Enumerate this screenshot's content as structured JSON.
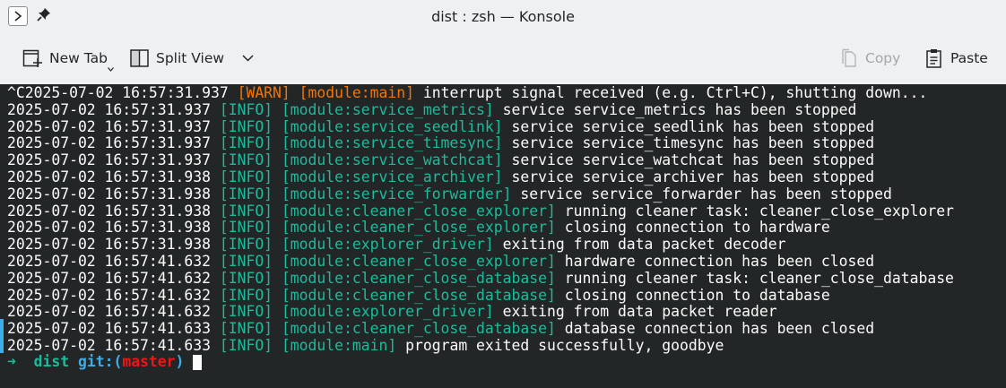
{
  "window": {
    "title": "dist : zsh — Konsole"
  },
  "toolbar": {
    "new_tab": "New Tab",
    "split_view": "Split View",
    "copy": "Copy",
    "paste": "Paste"
  },
  "log_lines": [
    {
      "ts": "^C2025-07-02 16:57:31.937",
      "level": "[WARN]",
      "module": "[module:main]",
      "msg": "interrupt signal received (e.g. Ctrl+C), shutting down..."
    },
    {
      "ts": "2025-07-02 16:57:31.937",
      "level": "[INFO]",
      "module": "[module:service_metrics]",
      "msg": "service service_metrics has been stopped"
    },
    {
      "ts": "2025-07-02 16:57:31.937",
      "level": "[INFO]",
      "module": "[module:service_seedlink]",
      "msg": "service service_seedlink has been stopped"
    },
    {
      "ts": "2025-07-02 16:57:31.937",
      "level": "[INFO]",
      "module": "[module:service_timesync]",
      "msg": "service service_timesync has been stopped"
    },
    {
      "ts": "2025-07-02 16:57:31.937",
      "level": "[INFO]",
      "module": "[module:service_watchcat]",
      "msg": "service service_watchcat has been stopped"
    },
    {
      "ts": "2025-07-02 16:57:31.938",
      "level": "[INFO]",
      "module": "[module:service_archiver]",
      "msg": "service service_archiver has been stopped"
    },
    {
      "ts": "2025-07-02 16:57:31.938",
      "level": "[INFO]",
      "module": "[module:service_forwarder]",
      "msg": "service service_forwarder has been stopped"
    },
    {
      "ts": "2025-07-02 16:57:31.938",
      "level": "[INFO]",
      "module": "[module:cleaner_close_explorer]",
      "msg": "running cleaner task: cleaner_close_explorer"
    },
    {
      "ts": "2025-07-02 16:57:31.938",
      "level": "[INFO]",
      "module": "[module:cleaner_close_explorer]",
      "msg": "closing connection to hardware"
    },
    {
      "ts": "2025-07-02 16:57:31.938",
      "level": "[INFO]",
      "module": "[module:explorer_driver]",
      "msg": "exiting from data packet decoder"
    },
    {
      "ts": "2025-07-02 16:57:41.632",
      "level": "[INFO]",
      "module": "[module:cleaner_close_explorer]",
      "msg": "hardware connection has been closed"
    },
    {
      "ts": "2025-07-02 16:57:41.632",
      "level": "[INFO]",
      "module": "[module:cleaner_close_database]",
      "msg": "running cleaner task: cleaner_close_database"
    },
    {
      "ts": "2025-07-02 16:57:41.632",
      "level": "[INFO]",
      "module": "[module:cleaner_close_database]",
      "msg": "closing connection to database"
    },
    {
      "ts": "2025-07-02 16:57:41.632",
      "level": "[INFO]",
      "module": "[module:explorer_driver]",
      "msg": "exiting from data packet reader"
    },
    {
      "ts": "2025-07-02 16:57:41.633",
      "level": "[INFO]",
      "module": "[module:cleaner_close_database]",
      "msg": "database connection has been closed"
    },
    {
      "ts": "2025-07-02 16:57:41.633",
      "level": "[INFO]",
      "module": "[module:main]",
      "msg": "program exited successfully, goodbye"
    }
  ],
  "prompt": {
    "arrow": "➜",
    "dir": "dist",
    "git_prefix": "git:(",
    "branch": "master",
    "git_suffix": ")"
  }
}
